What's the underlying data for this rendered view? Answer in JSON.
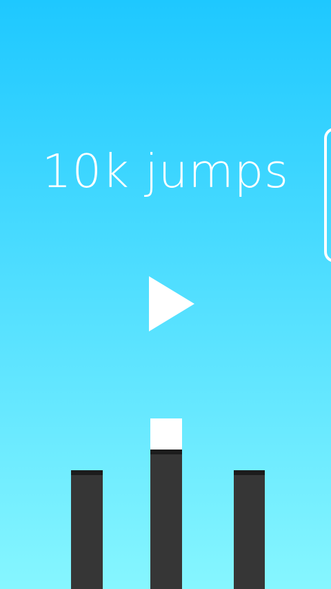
{
  "app": {
    "title": "10k jumps"
  },
  "colors": {
    "sky_top": "#1ec8ff",
    "sky_bottom": "#86f6ff",
    "pillar": "#363636",
    "pillar_cap": "#1c1c1c",
    "player": "#ffffff",
    "text": "#ffffff"
  },
  "controls": {
    "play_icon": "play-icon",
    "side_handle_icon": "edge-panel-handle"
  },
  "scene": {
    "pillars": 3,
    "player_on_pillar": 2
  }
}
